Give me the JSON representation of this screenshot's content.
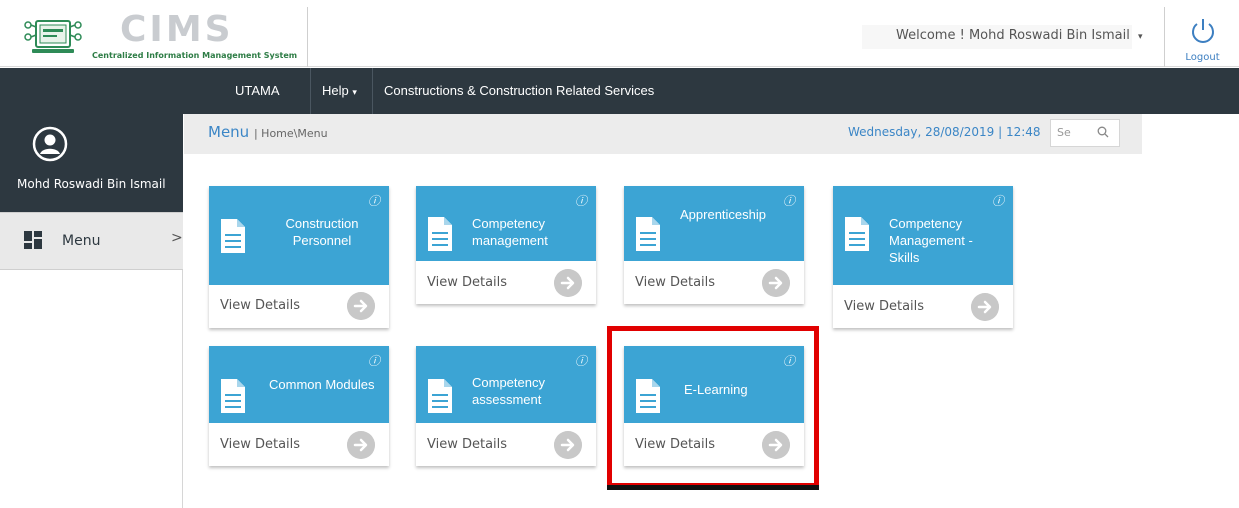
{
  "app": {
    "logo_word": "CIMS",
    "logo_subtitle": "Centralized Information Management System"
  },
  "header": {
    "welcome": "Welcome ! Mohd Roswadi Bin Ismail",
    "logout_label": "Logout"
  },
  "nav": {
    "items": [
      {
        "label": "UTAMA"
      },
      {
        "label": "Help"
      },
      {
        "label": "Constructions & Construction Related Services"
      }
    ]
  },
  "sidebar": {
    "user_name": "Mohd Roswadi Bin Ismail",
    "menu_label": "Menu",
    "menu_arrow": ">"
  },
  "breadcrumb": {
    "title": "Menu",
    "path": "| Home\\Menu",
    "datetime": "Wednesday, 28/08/2019 | 12:48",
    "search_placeholder": "Se"
  },
  "cards": [
    {
      "title": "Construction Personnel",
      "link": "View Details"
    },
    {
      "title": "Competency management",
      "link": "View Details"
    },
    {
      "title": "Apprenticeship",
      "link": "View Details"
    },
    {
      "title": "Competency Management - Skills",
      "link": "View Details"
    },
    {
      "title": "Common Modules",
      "link": "View Details"
    },
    {
      "title": "Competency assessment",
      "link": "View Details"
    },
    {
      "title": "E-Learning",
      "link": "View Details"
    }
  ],
  "icons": {
    "info": "ⓘ",
    "caret": "▾"
  },
  "colors": {
    "card_blue": "#3ca4d4",
    "navbar": "#2d3840",
    "accent_link": "#3b86c6",
    "highlight": "#e10000"
  }
}
